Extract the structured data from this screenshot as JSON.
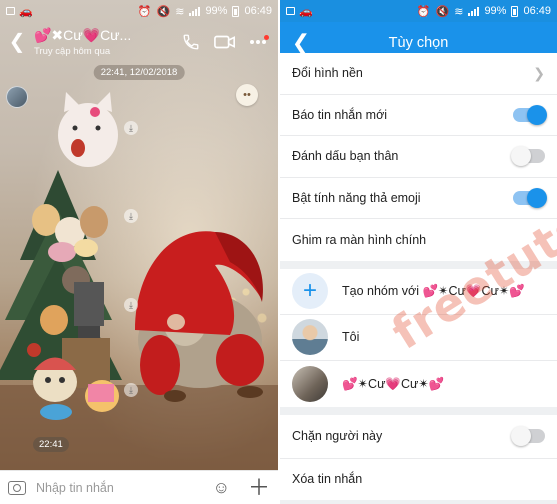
{
  "left": {
    "status": {
      "battery": "99%",
      "time": "06:49"
    },
    "header": {
      "title": "💕✖Cư💗Cư...",
      "subtitle": "Truy cập hôm qua"
    },
    "date_pill": "22:41, 12/02/2018",
    "time_pill": "22:41",
    "input": {
      "placeholder": "Nhập tin nhắn"
    }
  },
  "right": {
    "status": {
      "battery": "99%",
      "time": "06:49"
    },
    "header": {
      "title": "Tùy chọn"
    },
    "settings": [
      {
        "label": "Đổi hình nền",
        "control": "chevron"
      },
      {
        "label": "Báo tin nhắn mới",
        "control": "toggle",
        "on": true
      },
      {
        "label": "Đánh dấu bạn thân",
        "control": "toggle",
        "on": false
      },
      {
        "label": "Bật tính năng thả emoji",
        "control": "toggle",
        "on": true
      },
      {
        "label": "Ghim ra màn hình chính",
        "control": "none"
      }
    ],
    "members": [
      {
        "label": "Tạo nhóm với 💕✴Cư💗Cư✴💕"
      },
      {
        "label": "Tôi"
      },
      {
        "label": "💕✴Cư💗Cư✴💕"
      }
    ],
    "bottom": [
      {
        "label": "Chặn người này",
        "control": "toggle",
        "on": false
      },
      {
        "label": "Xóa tin nhắn"
      }
    ]
  },
  "watermark": "freetuts.net",
  "colors": {
    "accent": "#1a92ea",
    "toggle_on_track": "#8ec3f2",
    "toggle_off_track": "#cfd0d3"
  }
}
